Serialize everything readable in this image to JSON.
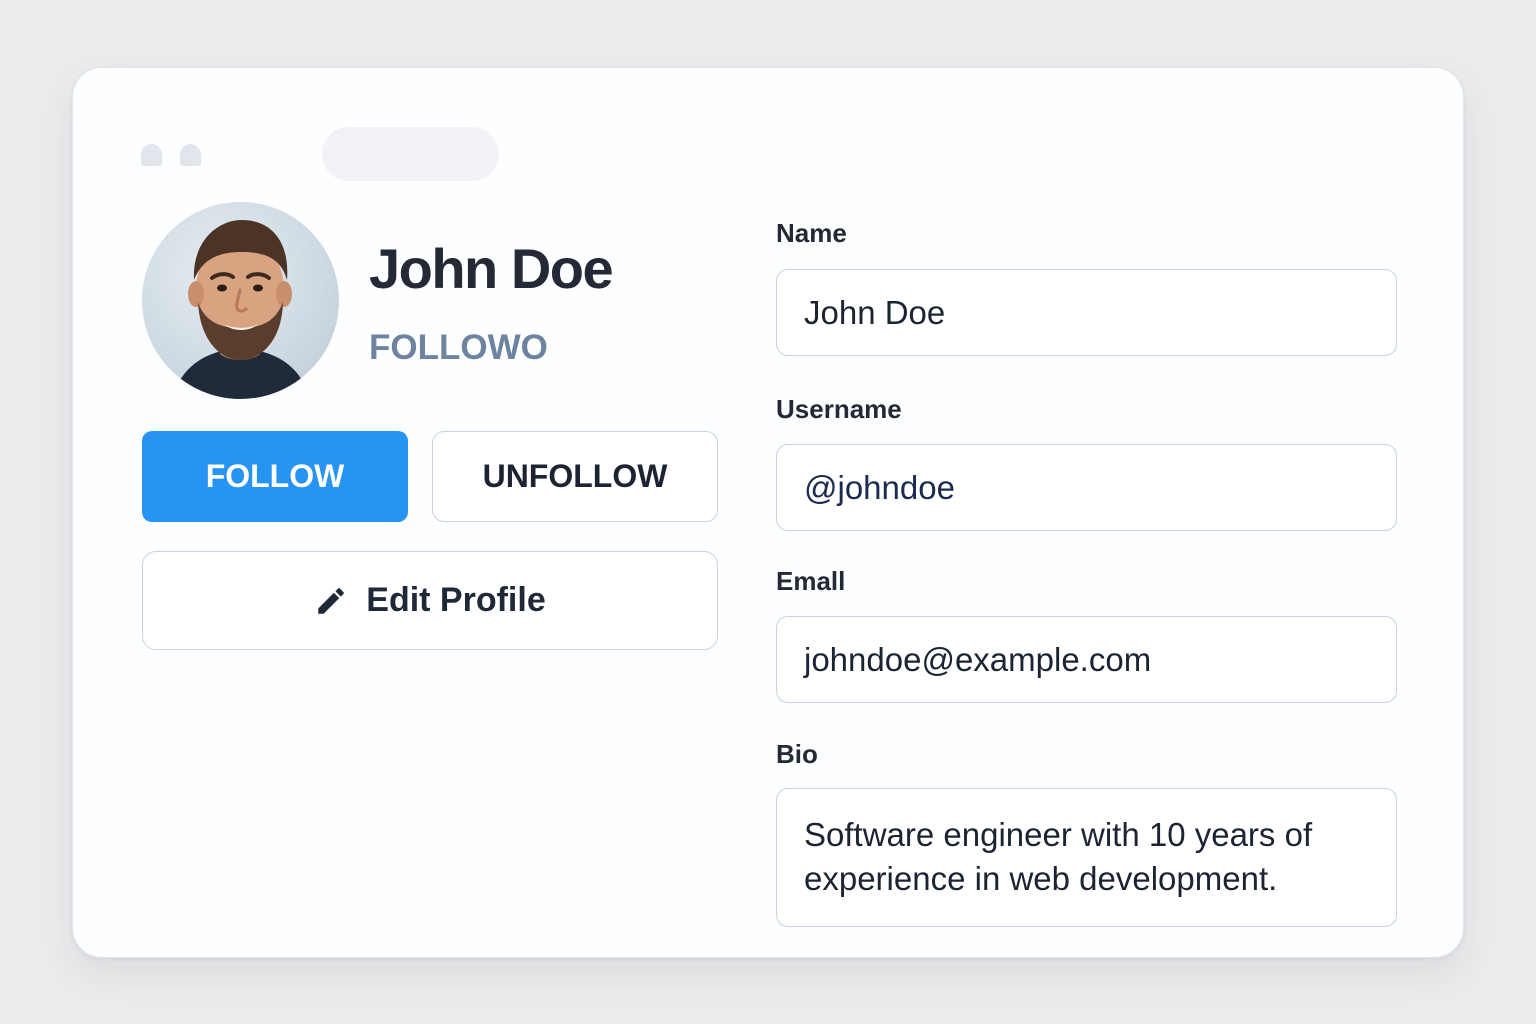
{
  "profile": {
    "name": "John Doe",
    "subtitle": "FOLLOWO",
    "avatar_icon": "person-photo"
  },
  "actions": {
    "follow_label": "FOLLOW",
    "unfollow_label": "UNFOLLOW",
    "edit_label": "Edit Profile",
    "edit_icon": "pencil-icon"
  },
  "form": {
    "name_label": "Name",
    "name_value": "John Doe",
    "username_label": "Username",
    "username_value": "@johndoe",
    "email_label": "Emall",
    "email_value": "johndoe@example.com",
    "bio_label": "Bio",
    "bio_value": "Software engineer with 10 years of experience in web development."
  },
  "colors": {
    "accent": "#2793f2",
    "background": "#ececed",
    "card": "#fdfeff",
    "text_primary": "#232a36",
    "text_muted": "#6d84a0",
    "border": "#c8d1dd"
  }
}
